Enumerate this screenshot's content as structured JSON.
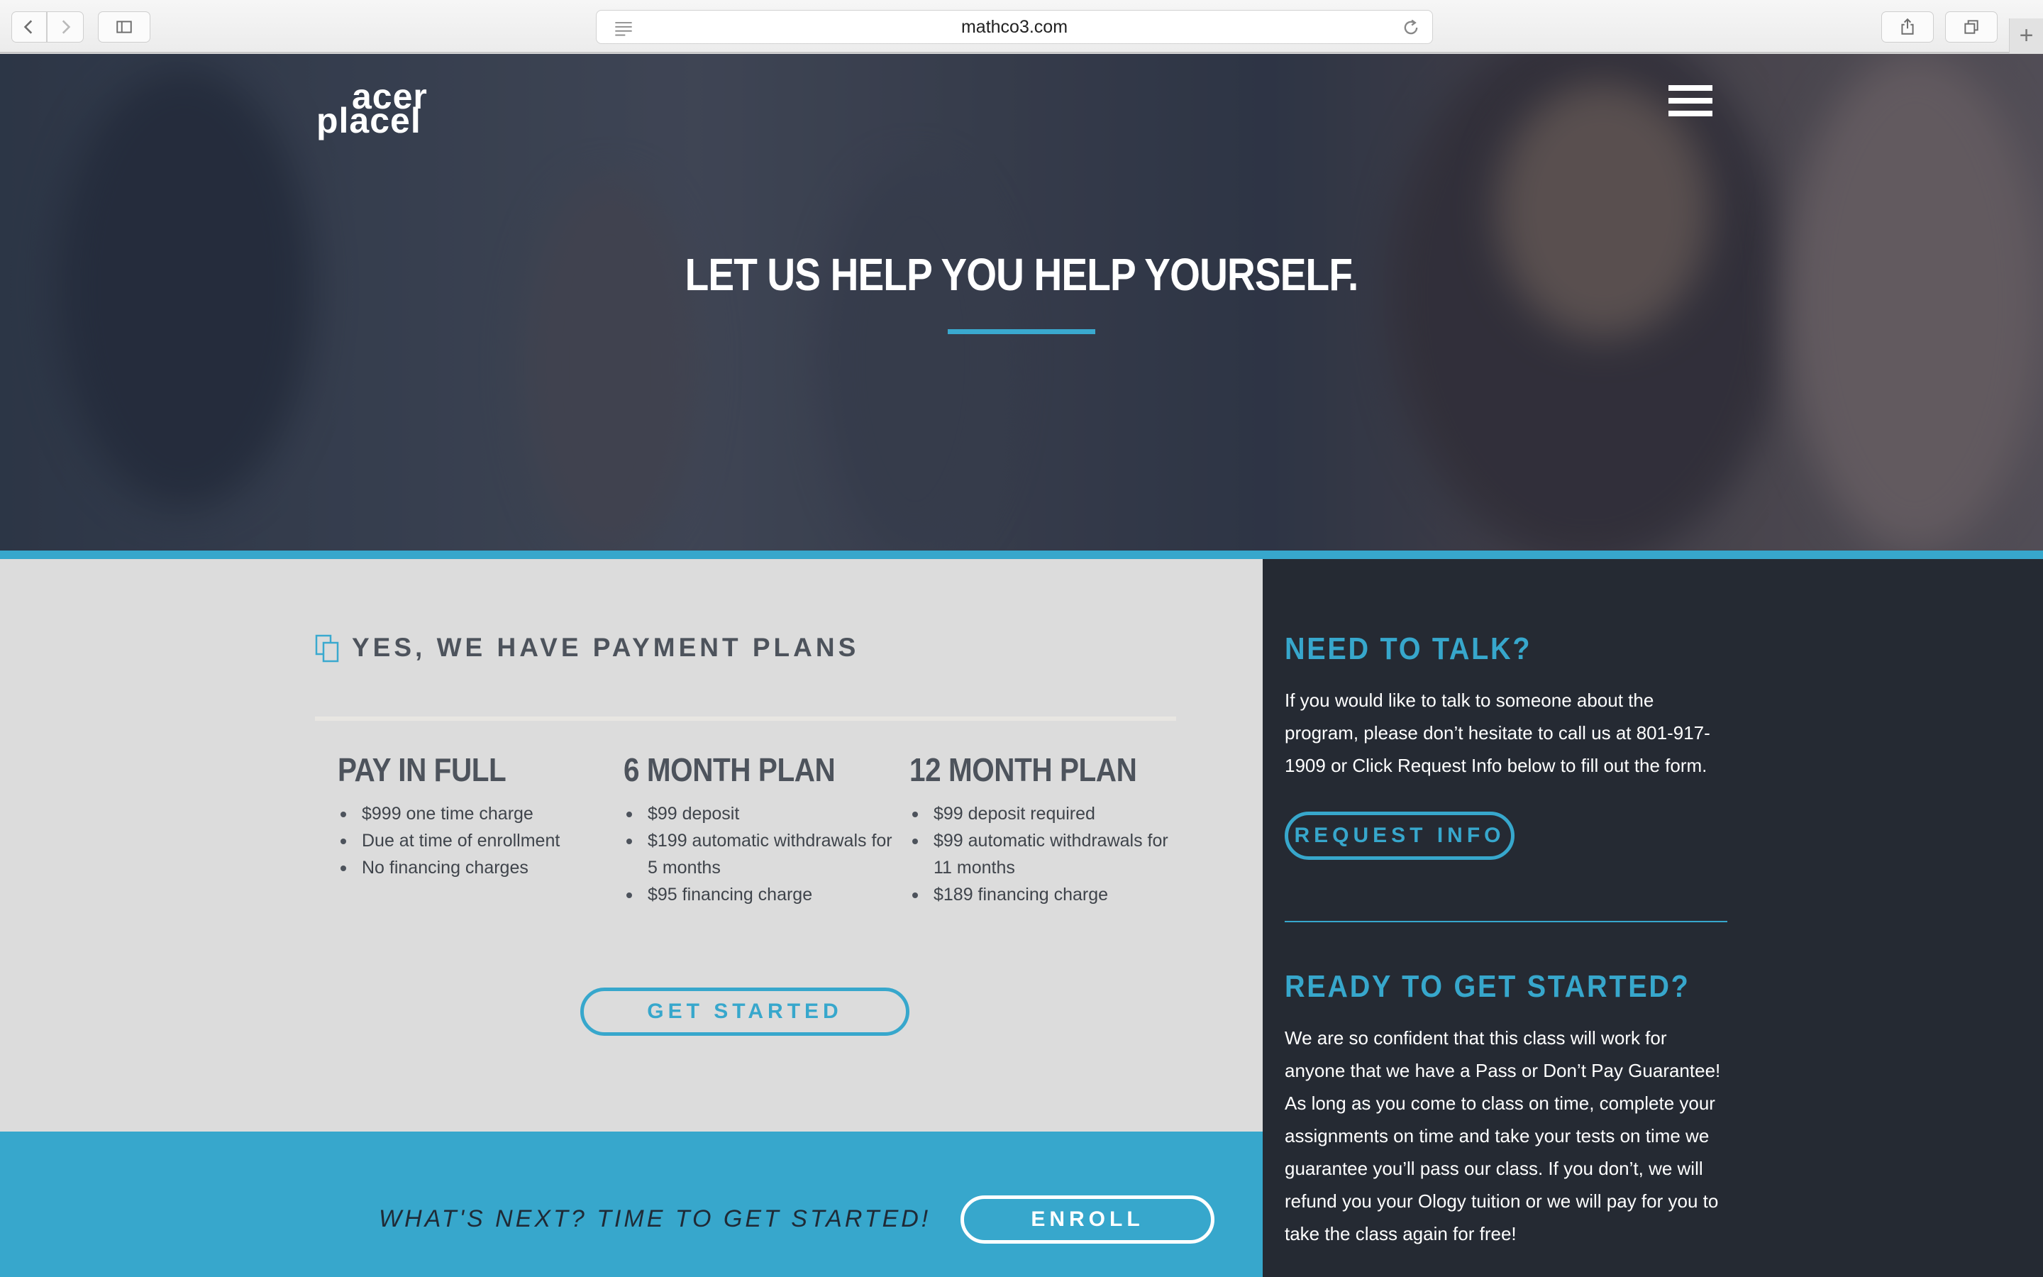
{
  "browser": {
    "url": "mathco3.com"
  },
  "hero": {
    "logo_top": "acer",
    "logo_bottom": "placel",
    "title": "LET US HELP YOU HELP YOURSELF."
  },
  "payment": {
    "heading": "YES, WE HAVE PAYMENT PLANS",
    "plans": [
      {
        "name": "PAY IN FULL",
        "items": [
          "$999 one time charge",
          "Due at time of enrollment",
          "No financing charges"
        ]
      },
      {
        "name": "6 MONTH PLAN",
        "items": [
          "$99 deposit",
          "$199 automatic withdrawals for 5 months",
          "$95 financing charge"
        ]
      },
      {
        "name": "12 MONTH PLAN",
        "items": [
          "$99 deposit required",
          "$99 automatic withdrawals for 11 months",
          "$189 financing charge"
        ]
      }
    ],
    "cta_label": "GET STARTED"
  },
  "enroll_bar": {
    "text": "WHAT'S NEXT? TIME TO GET STARTED!",
    "button_label": "ENROLL"
  },
  "sidebar": {
    "talk_heading": "NEED TO TALK?",
    "talk_text": "If you would like to talk to someone about the program, please don’t hesitate to call us at 801-917-1909 or Click Request Info below to fill out the form.",
    "request_label": "REQUEST INFO",
    "ready_heading": "READY TO GET STARTED?",
    "ready_text": "We are so confident that this class will work for anyone that we have a Pass or Don’t Pay Guarantee! As long as you come to class on time, complete your assignments on time and take your tests on time we guarantee you’ll pass our class. If you don’t, we will refund you your Ology tuition or we will pay for you to take the class again for free!"
  },
  "colors": {
    "accent": "#37a7cc",
    "dark_panel": "#252a33",
    "light_panel": "#dcdcdc"
  }
}
